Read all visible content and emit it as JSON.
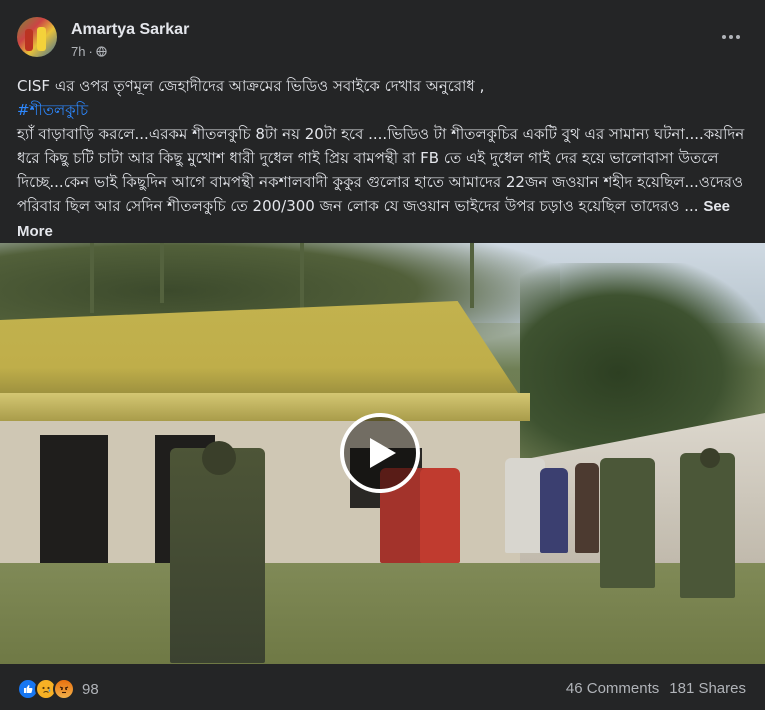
{
  "post": {
    "author": "Amartya Sarkar",
    "time": "7h",
    "separator": "·",
    "headline": "CISF এর ওপর তৃণমূল জেহাদীদের আক্রমের ভিডিও সবাইকে দেখার অনুরোধ ,",
    "hashtag": "#শীতলকুচি",
    "body": "হ্যাঁ বাড়াবাড়ি করলে...এরকম শীতলকুচি 8টা নয় 20টা হবে ....ভিডিও টা শীতলকুচির একটি বুথ এর সামান্য ঘটনা....কয়দিন ধরে কিছু চটি চাটা আর কিছু মুখোশ ধারী দুধেল গাই প্রিয় বামপন্থী রা FB তে এই দুধেল গাই দের হয়ে ভালোবাসা উতলে দিচ্ছে...কেন ভাই কিছুদিন আগে বামপন্থী নকশালবাদী কুকুর গুলোর হাতে আমাদের 22জন জওয়ান শহীদ হয়েছিল...ওদেরও পরিবার ছিল আর সেদিন শীতলকুচি তে 200/300 জন লোক যে জওয়ান ভাইদের উপর চড়াও হয়েছিল তাদেরও ...",
    "see_more": "See More"
  },
  "footer": {
    "reaction_count": "98",
    "comments": "46 Comments",
    "shares": "181 Shares"
  },
  "icons": {
    "more": "more-options-icon",
    "privacy": "globe-icon",
    "play": "play-icon",
    "like": "like-reaction-icon",
    "sad": "sad-reaction-icon",
    "angry": "angry-reaction-icon"
  },
  "colors": {
    "background": "#242526",
    "text": "#e4e6eb",
    "secondary_text": "#b0b3b8",
    "link": "#2d88ff",
    "like_blue": "#1877f2"
  }
}
